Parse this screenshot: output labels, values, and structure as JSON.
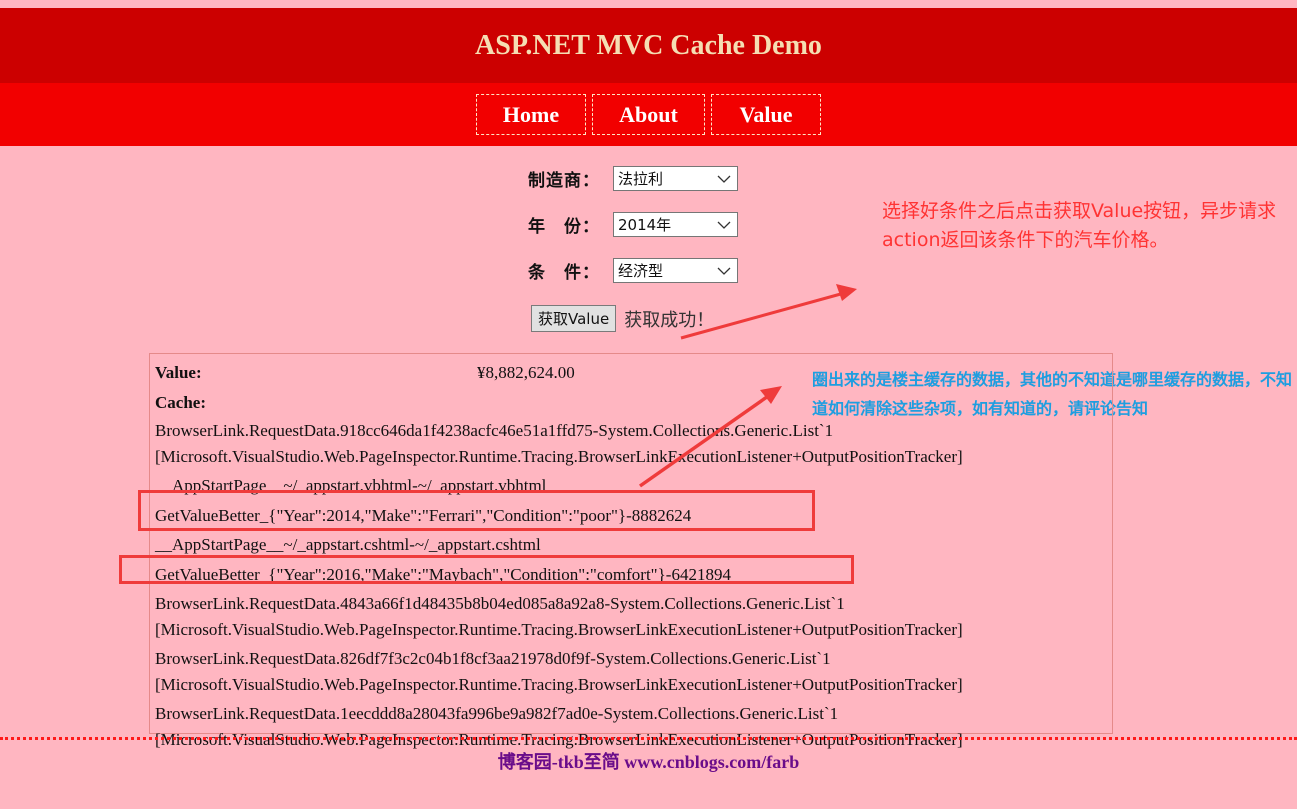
{
  "header": {
    "title": "ASP.NET MVC Cache Demo"
  },
  "nav": {
    "items": [
      "Home",
      "About",
      "Value"
    ]
  },
  "form": {
    "make": {
      "label": "制造商：",
      "value": "法拉利"
    },
    "year": {
      "label": "年　份：",
      "value": "2014年"
    },
    "condition": {
      "label": "条　件：",
      "value": "经济型"
    },
    "submit_label": "获取Value",
    "status": "获取成功！"
  },
  "result": {
    "value_label": "Value:",
    "value": "¥8,882,624.00",
    "cache_label": "Cache:",
    "entries": [
      [
        "BrowserLink.RequestData.918cc646da1f4238acfc46e51a1ffd75-System.Collections.Generic.List`1",
        "[Microsoft.VisualStudio.Web.PageInspector.Runtime.Tracing.BrowserLinkExecutionListener+OutputPositionTracker]"
      ],
      [
        "__AppStartPage__~/_appstart.vbhtml-~/_appstart.vbhtml"
      ],
      [
        "GetValueBetter_{\"Year\":2014,\"Make\":\"Ferrari\",\"Condition\":\"poor\"}-8882624"
      ],
      [
        "__AppStartPage__~/_appstart.cshtml-~/_appstart.cshtml"
      ],
      [
        "GetValueBetter_{\"Year\":2016,\"Make\":\"Maybach\",\"Condition\":\"comfort\"}-6421894"
      ],
      [
        "BrowserLink.RequestData.4843a66f1d48435b8b04ed085a8a92a8-System.Collections.Generic.List`1",
        "[Microsoft.VisualStudio.Web.PageInspector.Runtime.Tracing.BrowserLinkExecutionListener+OutputPositionTracker]"
      ],
      [
        "BrowserLink.RequestData.826df7f3c2c04b1f8cf3aa21978d0f9f-System.Collections.Generic.List`1",
        "[Microsoft.VisualStudio.Web.PageInspector.Runtime.Tracing.BrowserLinkExecutionListener+OutputPositionTracker]"
      ],
      [
        "BrowserLink.RequestData.1eecddd8a28043fa996be9a982f7ad0e-System.Collections.Generic.List`1",
        "[Microsoft.VisualStudio.Web.PageInspector.Runtime.Tracing.BrowserLinkExecutionListener+OutputPositionTracker]"
      ]
    ]
  },
  "annotations": {
    "red_note": "选择好条件之后点击获取Value按钮，异步请求action返回该条件下的汽车价格。",
    "blue_note": "圈出来的是楼主缓存的数据，其他的不知道是哪里缓存的数据，不知道如何清除这些杂项，如有知道的，请评论告知"
  },
  "footer": {
    "text": "博客园-tkb至简 www.cnblogs.com/farb"
  },
  "colors": {
    "page_bg": "#ffb6c1",
    "header_bg": "#cc0000",
    "nav_bg": "#f20000",
    "title_color": "#f5deb3",
    "annotation_red": "#ff3333",
    "annotation_blue": "#1e9ee0",
    "footer_color": "#6a0c8a"
  }
}
